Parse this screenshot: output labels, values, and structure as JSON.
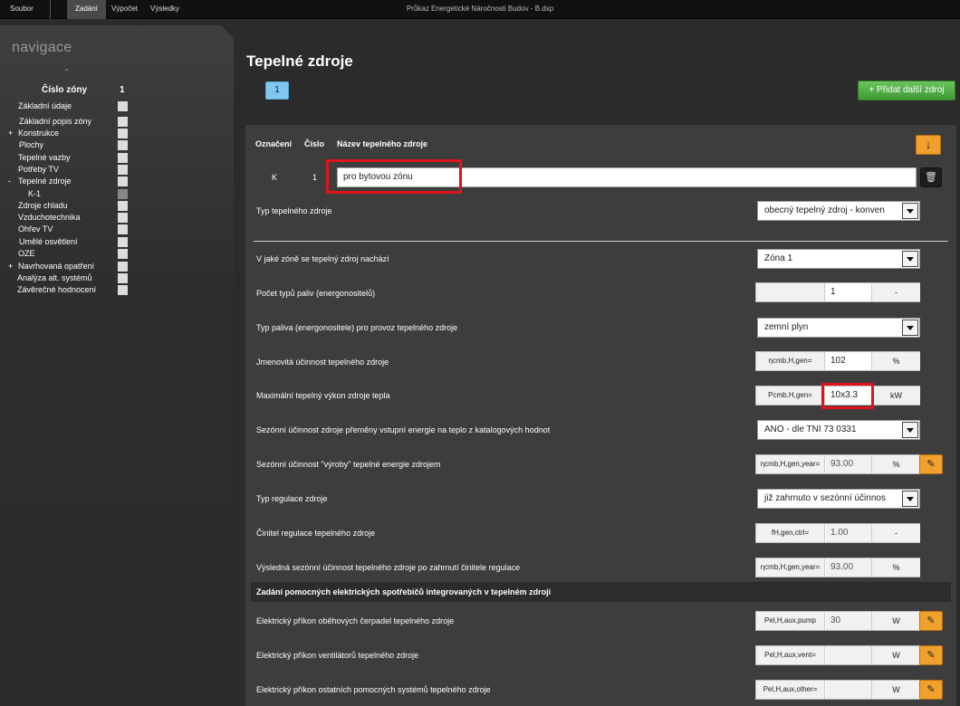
{
  "menu": {
    "soubor": "Soubor",
    "zadani": "Zadání",
    "vypocet": "Výpočet",
    "vysledky": "Výsledky"
  },
  "window_title": "Průkaz Energetické Náročnosti Budov - B.dxp",
  "sidebar": {
    "title": "navigace",
    "dash": "-",
    "zone_label": "Číslo zóny",
    "zone_number": "1",
    "items": [
      {
        "prefix": "",
        "label": "Základní údaje"
      },
      {
        "prefix": "",
        "label": "Základní popis zóny"
      },
      {
        "prefix": "+",
        "label": "Konstrukce"
      },
      {
        "prefix": "",
        "label": "Plochy"
      },
      {
        "prefix": "",
        "label": "Tepelné vazby"
      },
      {
        "prefix": "",
        "label": "Potřeby TV"
      },
      {
        "prefix": "-",
        "label": "Tepelné zdroje"
      },
      {
        "prefix": "",
        "label": "K-1"
      },
      {
        "prefix": "",
        "label": "Zdroje chladu"
      },
      {
        "prefix": "",
        "label": "Vzduchotechnika"
      },
      {
        "prefix": "",
        "label": "Ohřev TV"
      },
      {
        "prefix": "",
        "label": "Umělé osvětlení"
      },
      {
        "prefix": "",
        "label": "OZE"
      },
      {
        "prefix": "+",
        "label": "Navrhovaná opatření"
      },
      {
        "prefix": "",
        "label": "Analýza alt. systémů"
      },
      {
        "prefix": "",
        "label": "Závěrečné hodnocení"
      }
    ]
  },
  "main": {
    "title": "Tepelné zdroje",
    "tab_label": "1",
    "add_button": "+ Přidat další zdroj",
    "headers": {
      "oznaceni": "Označení",
      "cislo": "Číslo",
      "nazev": "Název tepelného zdroje"
    },
    "collapse_icon": "↓",
    "source": {
      "oznaceni": "K",
      "cislo": "1",
      "nazev": "pro  bytovou zónu"
    },
    "trash_icon": "🗑",
    "typ": {
      "label": "Typ tepelného zdroje",
      "value": "obecný tepelný zdroj - konven"
    },
    "zona": {
      "label": "V jaké zóně se tepelný zdroj nachází",
      "value": "Zóna 1"
    },
    "pocet_paliv": {
      "label": "Počet typů paliv (energonositelů)",
      "value": "1",
      "unit": "-"
    },
    "palivo": {
      "label": "Typ paliva (energonositele) pro provoz tepelného zdroje",
      "value": "zemní plyn"
    },
    "ucinnost": {
      "label": "Jmenovitá účinnost tepelného zdroje",
      "sym": "ηcmb,H,gen=",
      "value": "102",
      "unit": "%"
    },
    "vykon": {
      "label": "Maximální tepelný výkon zdroje tepla",
      "sym": "Pcmb,H,gen=",
      "value": "10x3.3",
      "unit": "kW"
    },
    "sezonni_katalog": {
      "label": "Sezónní účinnost zdroje přeměny vstupní energie na teplo z katalogových hodnot",
      "value": "ANO - dle TNI 73 0331"
    },
    "sezonni_vyroby": {
      "label": "Sezónní účinnost \"výroby\" tepelné energie zdrojem",
      "sym": "ηcmb,H,gen,year=",
      "value": "93.00",
      "unit": "%"
    },
    "regulace": {
      "label": "Typ regulace zdroje",
      "value": "již zahrnuto v sezónní účinnos"
    },
    "cinitel": {
      "label": "Činitel regulace tepelného zdroje",
      "sym": "fH,gen,ctrl=",
      "value": "1.00",
      "unit": "-"
    },
    "vysledna": {
      "label": "Výsledná sezónní účinnost tepelného zdroje po zahrnutí činitele regulace",
      "sym": "ηcmb,H,gen,year=",
      "value": "93.00",
      "unit": "%"
    },
    "section_aux": "Zadání pomocných elektrických spotřebičů integrovaných v tepelném zdroji",
    "pump": {
      "label": "Elektrický příkon oběhových čerpadel tepelného zdroje",
      "sym": "Pel,H,aux,pump",
      "value": "30",
      "unit": "W"
    },
    "vent": {
      "label": "Elektrický příkon ventilátorů tepelného zdroje",
      "sym": "Pel,H,aux,vent=",
      "value": "",
      "unit": "W"
    },
    "other": {
      "label": "Elektrický příkon ostatních pomocných systémů tepelného zdroje",
      "sym": "Pel,H,aux,other=",
      "value": "",
      "unit": "W"
    },
    "edit_icon": "✎"
  }
}
